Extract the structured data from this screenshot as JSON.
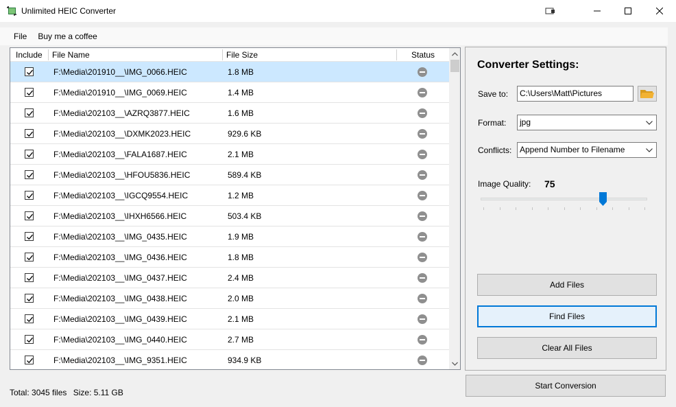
{
  "window": {
    "title": "Unlimited HEIC Converter"
  },
  "menu": [
    "File",
    "Buy me a coffee"
  ],
  "columns": {
    "include": "Include",
    "file_name": "File Name",
    "file_size": "File Size",
    "status": "Status"
  },
  "files": [
    {
      "name": "F:\\Media\\201910__\\IMG_0066.HEIC",
      "size": "1.8 MB",
      "checked": true,
      "selected": true
    },
    {
      "name": "F:\\Media\\201910__\\IMG_0069.HEIC",
      "size": "1.4 MB",
      "checked": true
    },
    {
      "name": "F:\\Media\\202103__\\AZRQ3877.HEIC",
      "size": "1.6 MB",
      "checked": true
    },
    {
      "name": "F:\\Media\\202103__\\DXMK2023.HEIC",
      "size": "929.6 KB",
      "checked": true
    },
    {
      "name": "F:\\Media\\202103__\\FALA1687.HEIC",
      "size": "2.1 MB",
      "checked": true
    },
    {
      "name": "F:\\Media\\202103__\\HFOU5836.HEIC",
      "size": "589.4 KB",
      "checked": true
    },
    {
      "name": "F:\\Media\\202103__\\IGCQ9554.HEIC",
      "size": "1.2 MB",
      "checked": true
    },
    {
      "name": "F:\\Media\\202103__\\IHXH6566.HEIC",
      "size": "503.4 KB",
      "checked": true
    },
    {
      "name": "F:\\Media\\202103__\\IMG_0435.HEIC",
      "size": "1.9 MB",
      "checked": true
    },
    {
      "name": "F:\\Media\\202103__\\IMG_0436.HEIC",
      "size": "1.8 MB",
      "checked": true
    },
    {
      "name": "F:\\Media\\202103__\\IMG_0437.HEIC",
      "size": "2.4 MB",
      "checked": true
    },
    {
      "name": "F:\\Media\\202103__\\IMG_0438.HEIC",
      "size": "2.0 MB",
      "checked": true
    },
    {
      "name": "F:\\Media\\202103__\\IMG_0439.HEIC",
      "size": "2.1 MB",
      "checked": true
    },
    {
      "name": "F:\\Media\\202103__\\IMG_0440.HEIC",
      "size": "2.7 MB",
      "checked": true
    },
    {
      "name": "F:\\Media\\202103__\\IMG_9351.HEIC",
      "size": "934.9 KB",
      "checked": true
    }
  ],
  "footer": {
    "total": "Total: 3045 files",
    "size": "Size: 5.11 GB"
  },
  "settings": {
    "title": "Converter Settings:",
    "save_to_label": "Save to:",
    "save_to_value": "C:\\Users\\Matt\\Pictures",
    "format_label": "Format:",
    "format_value": "jpg",
    "conflicts_label": "Conflicts:",
    "conflicts_value": "Append Number to Filename",
    "quality_label": "Image Quality:",
    "quality_value": "75",
    "quality_level": 75
  },
  "buttons": {
    "add_files": "Add Files",
    "find_files": "Find Files",
    "clear_all": "Clear All Files",
    "start": "Start Conversion"
  },
  "colors": {
    "selection": "#cce8ff",
    "focus": "#0078d7",
    "folder": "#f2b233"
  }
}
